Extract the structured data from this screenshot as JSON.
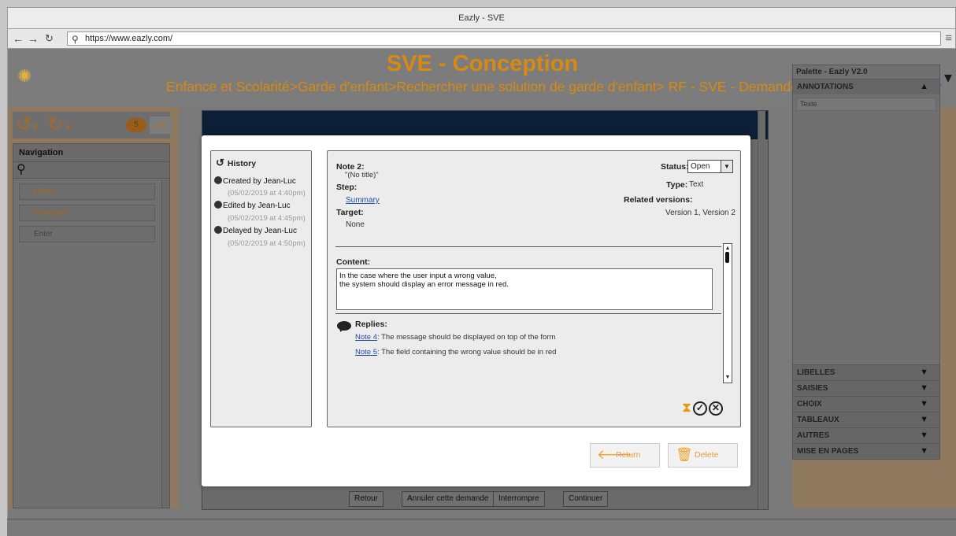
{
  "browser": {
    "window_title": "Eazly - SVE",
    "url": "https://www.eazly.com/"
  },
  "app": {
    "title": "SVE - Conception",
    "breadcrumb": "Enfance et Scolarité>Garde d'enfant>Rechercher une solution de garde d'enfant> RF - SVE - Demande"
  },
  "toolbar": {
    "notes_count": "5",
    "language": "EN"
  },
  "navigation": {
    "title": "Navigation",
    "items": [
      {
        "label": "Home"
      },
      {
        "label": "Summary"
      },
      {
        "label": "Enter"
      }
    ]
  },
  "center": {
    "bottom_buttons": [
      "Retour",
      "Annuler cette demande",
      "Interrompre",
      "Continuer"
    ]
  },
  "palette": {
    "title": "Palette - Eazly V2.0",
    "top_section": "ANNOTATIONS",
    "top_items": [
      "Texte"
    ],
    "sections": [
      "LIBELLES",
      "SAISIES",
      "CHOIX",
      "TABLEAUX",
      "AUTRES",
      "MISE EN PAGES"
    ]
  },
  "history": {
    "title": "History",
    "entries": [
      {
        "text": "Created by Jean-Luc",
        "date": "(05/02/2019 at 4:40pm)"
      },
      {
        "text": "Edited by Jean-Luc",
        "date": "(05/02/2019 at 4:45pm)"
      },
      {
        "text": "Delayed by Jean-Luc",
        "date": "(05/02/2019 at 4:50pm)"
      }
    ]
  },
  "note": {
    "heading": "Note 2:",
    "title_value": "\"(No title)\"",
    "step_label": "Step:",
    "step_value": "Summary",
    "target_label": "Target:",
    "target_value": "None",
    "status_label": "Status:",
    "status_value": "Open",
    "type_label": "Type:",
    "type_value": "Text",
    "related_label": "Related versions:",
    "related_value": "Version 1, Version 2",
    "content_label": "Content:",
    "content_line1": "In the case where the user input a wrong value,",
    "content_line2": "the system should display an error message in red.",
    "replies_label": "Replies:",
    "replies": [
      {
        "link": "Note 4",
        "text": ": The message should be displayed on top of the form"
      },
      {
        "link": "Note 5",
        "text": ": The field containing the wrong value should be in red"
      }
    ]
  },
  "buttons": {
    "return_label": "Return",
    "delete_label": "Delete"
  },
  "colors": {
    "accent": "#d78a12",
    "link": "#1f4ea8",
    "button_text": "#e5a040"
  }
}
